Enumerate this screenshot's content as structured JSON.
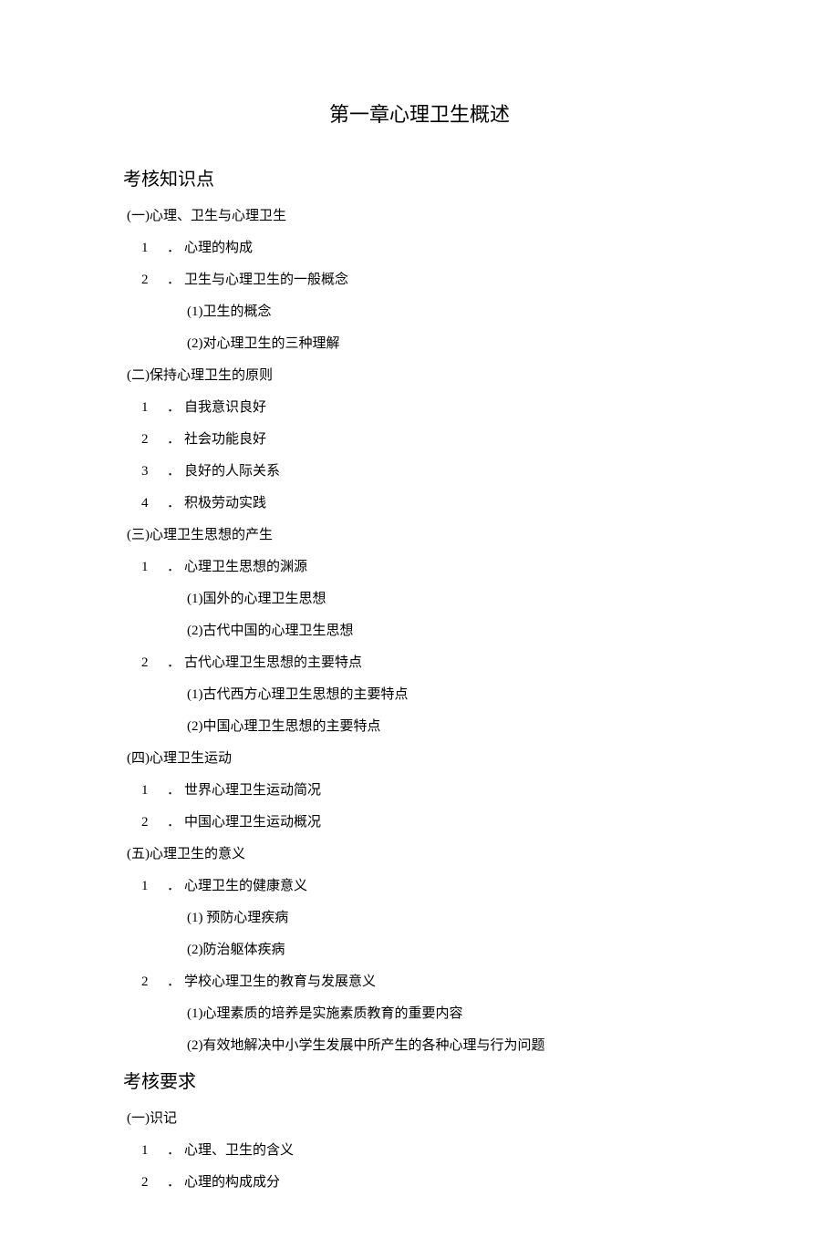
{
  "title": "第一章心理卫生概述",
  "sections": [
    {
      "heading": "考核知识点",
      "items": [
        {
          "level": 1,
          "text": "(一)心理、卫生与心理卫生"
        },
        {
          "level": 2,
          "number": "1",
          "text": "心理的构成"
        },
        {
          "level": 2,
          "number": "2",
          "text": "卫生与心理卫生的一般概念"
        },
        {
          "level": 3,
          "text": "(1)卫生的概念"
        },
        {
          "level": 3,
          "text": "(2)对心理卫生的三种理解"
        },
        {
          "level": 1,
          "text": "(二)保持心理卫生的原则"
        },
        {
          "level": 2,
          "number": "1",
          "text": "自我意识良好"
        },
        {
          "level": 2,
          "number": "2",
          "text": "社会功能良好"
        },
        {
          "level": 2,
          "number": "3",
          "text": "良好的人际关系"
        },
        {
          "level": 2,
          "number": "4",
          "text": "积极劳动实践"
        },
        {
          "level": 1,
          "text": "(三)心理卫生思想的产生"
        },
        {
          "level": 2,
          "number": "1",
          "text": "心理卫生思想的渊源"
        },
        {
          "level": 3,
          "text": "(1)国外的心理卫生思想"
        },
        {
          "level": 3,
          "text": "(2)古代中国的心理卫生思想"
        },
        {
          "level": 2,
          "number": "2",
          "text": "古代心理卫生思想的主要特点"
        },
        {
          "level": 3,
          "text": "(1)古代西方心理卫生思想的主要特点"
        },
        {
          "level": 3,
          "text": "(2)中国心理卫生思想的主要特点"
        },
        {
          "level": 1,
          "text": "(四)心理卫生运动"
        },
        {
          "level": 2,
          "number": "1",
          "text": "世界心理卫生运动简况"
        },
        {
          "level": 2,
          "number": "2",
          "text": "中国心理卫生运动概况"
        },
        {
          "level": 1,
          "text": "(五)心理卫生的意义"
        },
        {
          "level": 2,
          "number": "1",
          "text": "心理卫生的健康意义"
        },
        {
          "level": 3,
          "text": "(1) 预防心理疾病"
        },
        {
          "level": 3,
          "text": "(2)防治躯体疾病"
        },
        {
          "level": 2,
          "number": "2",
          "text": "学校心理卫生的教育与发展意义"
        },
        {
          "level": 3,
          "text": "(1)心理素质的培养是实施素质教育的重要内容"
        },
        {
          "level": 3,
          "text": "(2)有效地解决中小学生发展中所产生的各种心理与行为问题"
        }
      ]
    },
    {
      "heading": "考核要求",
      "items": [
        {
          "level": 1,
          "text": "(一)识记"
        },
        {
          "level": 2,
          "number": "1",
          "text": "心理、卫生的含义"
        },
        {
          "level": 2,
          "number": "2",
          "text": "心理的构成成分"
        }
      ]
    }
  ]
}
